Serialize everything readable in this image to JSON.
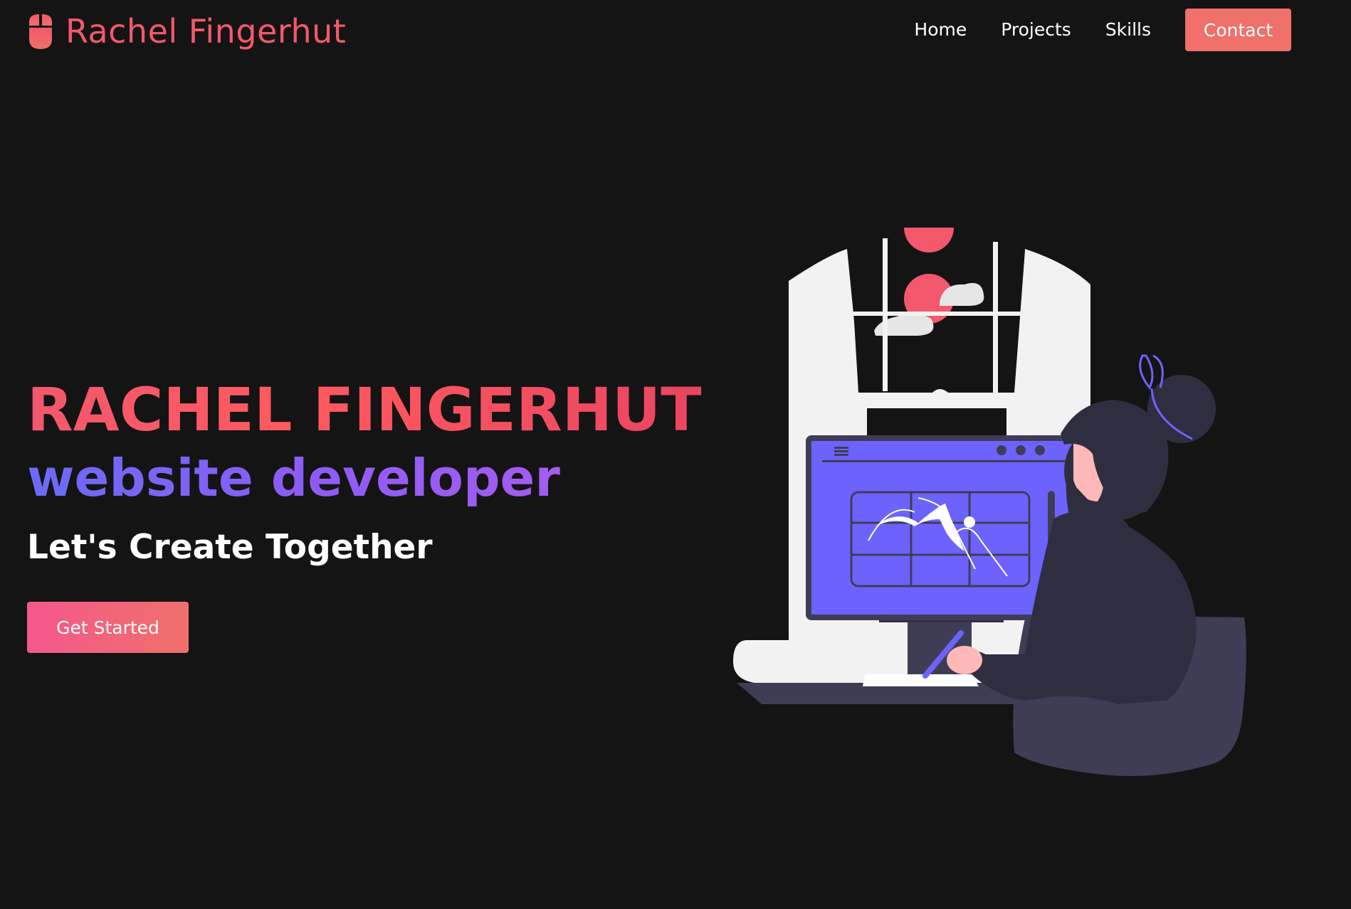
{
  "navbar": {
    "brand_icon": "mouse-icon",
    "brand_name": "Rachel Fingerhut",
    "links": [
      {
        "label": "Home"
      },
      {
        "label": "Projects"
      },
      {
        "label": "Skills"
      }
    ],
    "contact_label": "Contact"
  },
  "hero": {
    "name": "RACHEL FINGERHUT",
    "role": "website developer",
    "tagline": "Let's Create Together",
    "cta_label": "Get Started"
  },
  "illustration": {
    "icon": "woman-at-computer-illustration"
  },
  "colors": {
    "background": "#141414",
    "accent_coral": "#f0706a",
    "accent_red": "#f3586c",
    "accent_purple": "#6c63ff",
    "text": "#ffffff"
  }
}
